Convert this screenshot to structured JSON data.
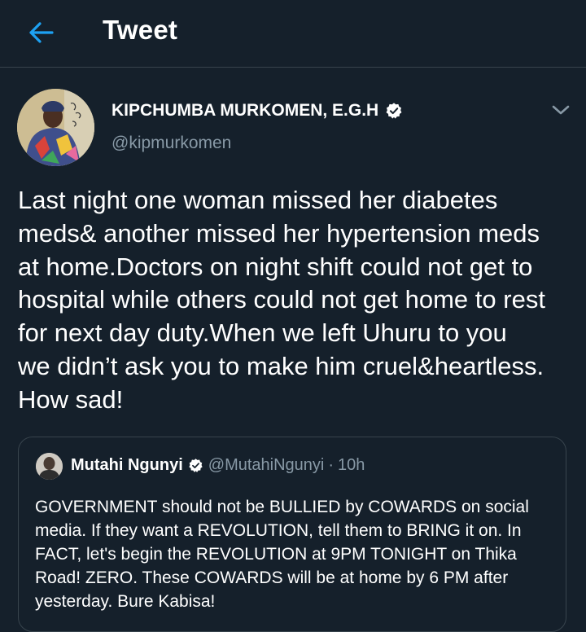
{
  "header": {
    "title": "Tweet",
    "back_icon": "arrow-left-icon"
  },
  "author": {
    "display_name": "KIPCHUMBA MURKOMEN, E.G.H",
    "handle": "@kipmurkomen",
    "verified": true,
    "menu_icon": "chevron-down-icon"
  },
  "tweet": {
    "text": "Last night one woman missed her diabetes\nmeds& another missed her hypertension meds\nat home.Doctors on night shift could not get to\nhospital while others could not get home to rest\nfor next day duty.When we left Uhuru to you\nwe didn’t ask you to make him cruel&heartless.\nHow sad!"
  },
  "quoted_tweet": {
    "display_name": "Mutahi Ngunyi",
    "handle": "@MutahiNgunyi",
    "separator": "·",
    "time": "10h",
    "text": "GOVERNMENT should not be BULLIED by COWARDS on social\nmedia. If they want a REVOLUTION, tell them to BRING it on. In\nFACT, let's begin the REVOLUTION at 9PM TONIGHT on Thika\nRoad! ZERO. These COWARDS will be at home by 6 PM after\nyesterday. Bure Kabisa!"
  },
  "colors": {
    "background": "#15202b",
    "accent": "#1da1f2",
    "secondary_text": "#8899a6",
    "border": "#38444d"
  }
}
